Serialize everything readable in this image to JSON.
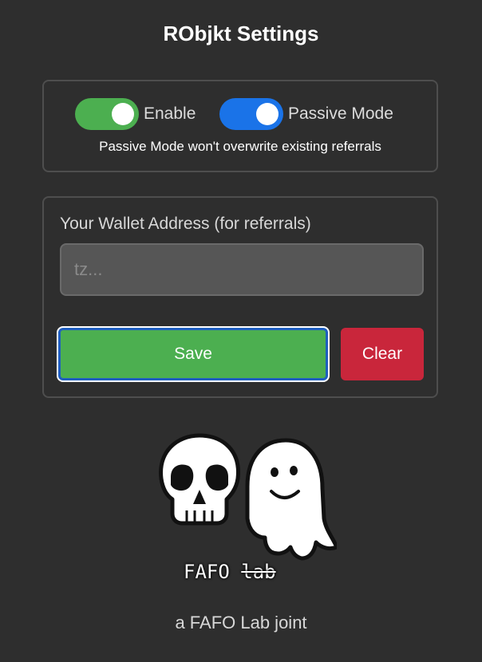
{
  "header": {
    "title": "RObjkt Settings"
  },
  "toggles": {
    "enable": {
      "label": "Enable",
      "on": true,
      "color": "#4caf50"
    },
    "passive_mode": {
      "label": "Passive Mode",
      "on": true,
      "color": "#1a73e8"
    },
    "note": "Passive Mode won't overwrite existing referrals"
  },
  "wallet": {
    "label": "Your Wallet Address (for referrals)",
    "value": "",
    "placeholder": "tz..."
  },
  "buttons": {
    "save_label": "Save",
    "clear_label": "Clear",
    "save_color": "#4caf50",
    "clear_color": "#c9263b"
  },
  "logo": {
    "text_main": "FAFO",
    "text_strike": "lab",
    "icons": [
      "skull-icon",
      "ghost-icon"
    ]
  },
  "footer": {
    "text": "a FAFO Lab joint"
  }
}
